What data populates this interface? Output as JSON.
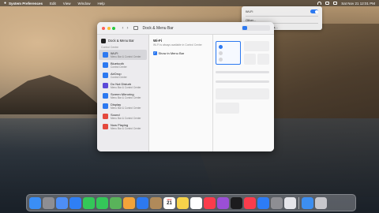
{
  "menubar": {
    "app_name": "System Preferences",
    "menus": [
      "Edit",
      "View",
      "Window",
      "Help"
    ],
    "clock": "Sat Nov 21  12:01 PM"
  },
  "wifi_menu": {
    "title": "Wi-Fi",
    "toggle_on": true,
    "network": "Other...",
    "prefs": "Network Preferences..."
  },
  "window": {
    "title": "Dock & Menu Bar"
  },
  "sidebar": {
    "header": "Dock & Menu Bar",
    "section": "Control Centre",
    "items": [
      {
        "label": "Wi-Fi",
        "sub": "Menu Bar & Control Center",
        "color": "#2d79f0"
      },
      {
        "label": "Bluetooth",
        "sub": "Control Center",
        "color": "#2d79f0"
      },
      {
        "label": "AirDrop",
        "sub": "Control Center",
        "color": "#2d79f0"
      },
      {
        "label": "Do Not Disturb",
        "sub": "Menu Bar & Control Center",
        "color": "#5d4ad8"
      },
      {
        "label": "Screen Mirroring",
        "sub": "Menu Bar & Control Center",
        "color": "#2d79f0"
      },
      {
        "label": "Display",
        "sub": "Menu Bar & Control Center",
        "color": "#2d79f0"
      },
      {
        "label": "Sound",
        "sub": "Menu Bar & Control Center",
        "color": "#e4493d"
      },
      {
        "label": "Now Playing",
        "sub": "Menu Bar & Control Center",
        "color": "#e4493d"
      }
    ]
  },
  "content": {
    "heading": "Wi-Fi",
    "description": "Wi-Fi is always available in Control Center",
    "show_in_menu_bar": "Show in Menu Bar"
  },
  "calendar": {
    "month": "NOV",
    "day": "21"
  },
  "dock": [
    {
      "name": "finder-icon",
      "color": "#3a8ef6"
    },
    {
      "name": "launchpad-icon",
      "color": "#8e8e93"
    },
    {
      "name": "contacts-icon",
      "color": "#4e8ef5"
    },
    {
      "name": "mail-icon",
      "color": "#2f7ff5"
    },
    {
      "name": "facetime-icon",
      "color": "#34c759"
    },
    {
      "name": "messages-icon",
      "color": "#34c759"
    },
    {
      "name": "maps-icon",
      "color": "#59b35a"
    },
    {
      "name": "photos-icon",
      "color": "#f2a33a"
    },
    {
      "name": "safari-icon",
      "color": "#2d79f0"
    },
    {
      "name": "contacts-book-icon",
      "color": "#b08a5a"
    },
    {
      "name": "calendar-icon",
      "color": "#ffffff"
    },
    {
      "name": "notes-icon",
      "color": "#f7d34a"
    },
    {
      "name": "reminders-icon",
      "color": "#ffffff"
    },
    {
      "name": "music-icon",
      "color": "#fa3c4c"
    },
    {
      "name": "podcasts-icon",
      "color": "#9b4fd6"
    },
    {
      "name": "tv-icon",
      "color": "#1c1c1e"
    },
    {
      "name": "news-icon",
      "color": "#fa3c4c"
    },
    {
      "name": "app-store-icon",
      "color": "#2d7cf6"
    },
    {
      "name": "system-preferences-icon",
      "color": "#8e8e93"
    },
    {
      "name": "wifi-diagnostics-icon",
      "color": "#e5e5ea"
    },
    {
      "name": "downloads-icon",
      "color": "#3d8ef0"
    },
    {
      "name": "trash-icon",
      "color": "#c7c7cc"
    }
  ]
}
